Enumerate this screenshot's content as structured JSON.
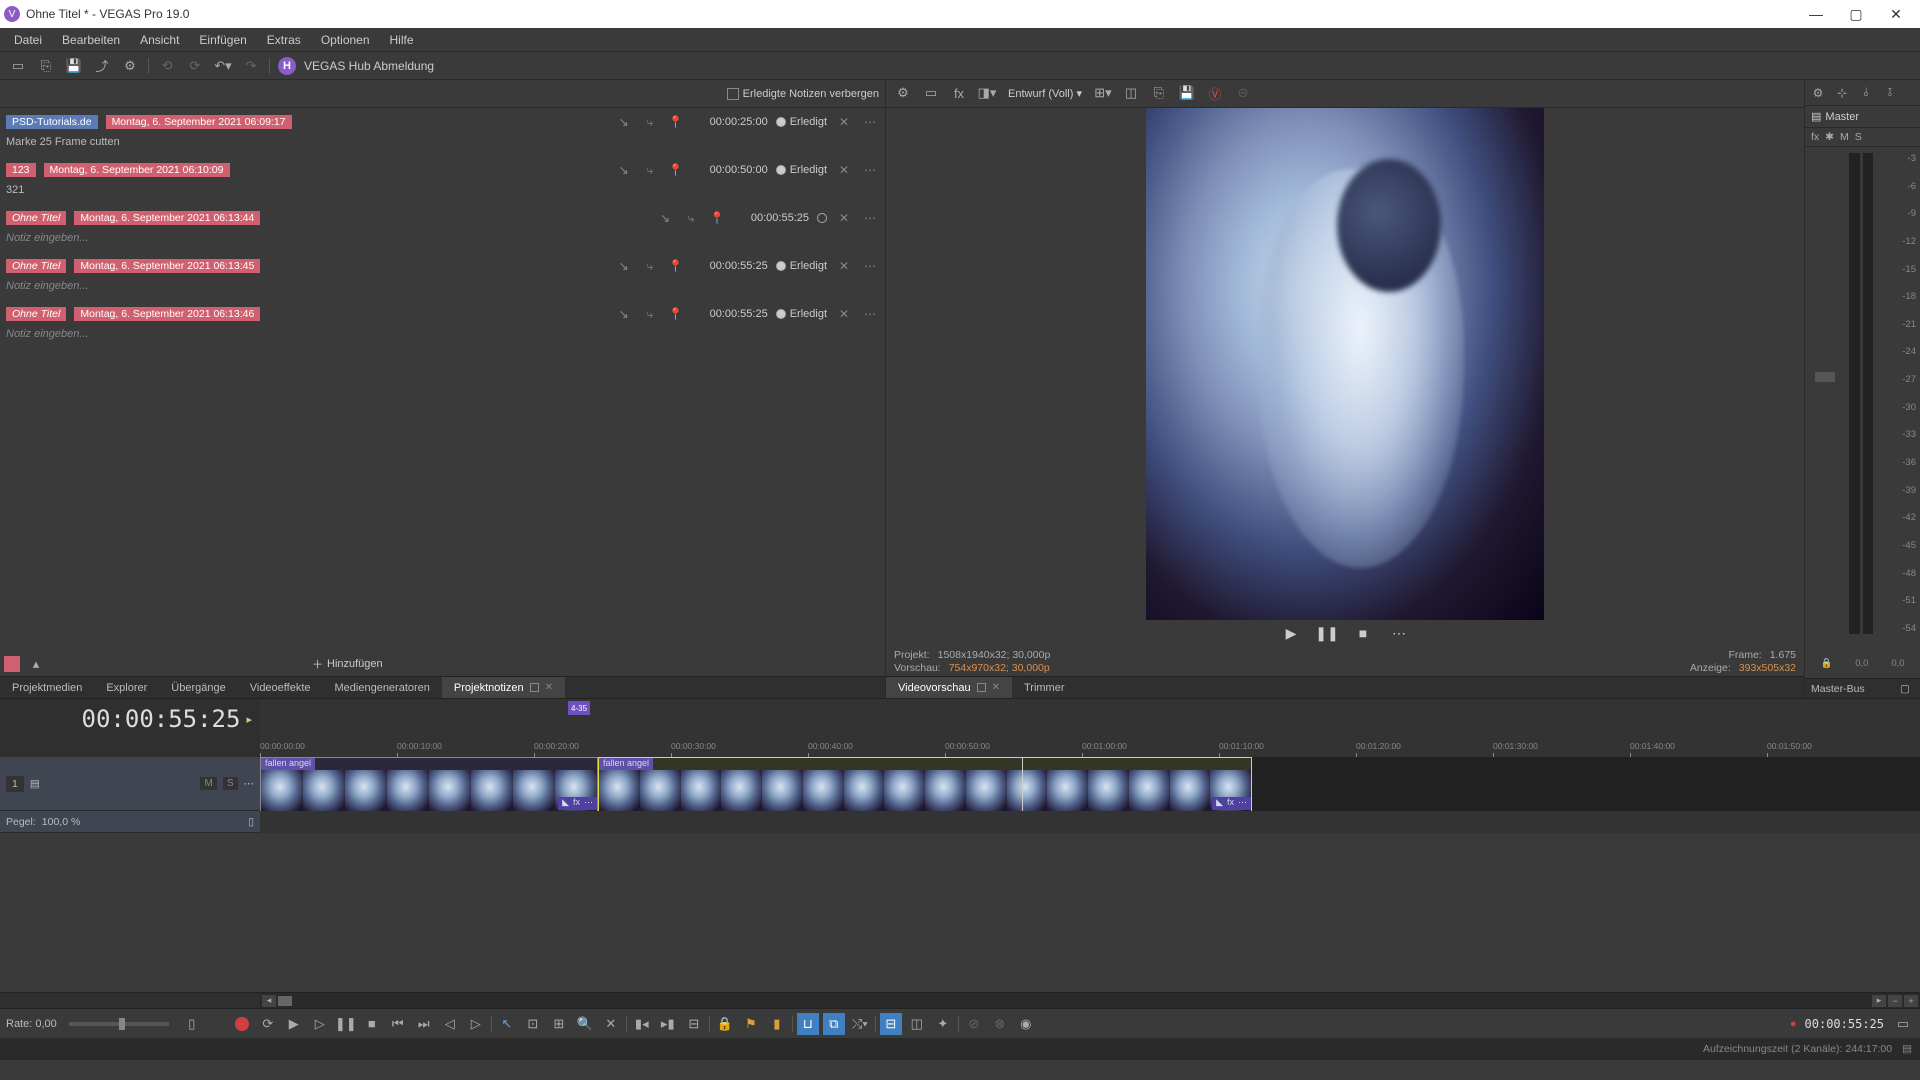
{
  "window": {
    "title": "Ohne Titel * - VEGAS Pro 19.0",
    "logo_char": "V"
  },
  "menu": [
    "Datei",
    "Bearbeiten",
    "Ansicht",
    "Einfügen",
    "Extras",
    "Optionen",
    "Hilfe"
  ],
  "hub": {
    "char": "H",
    "text": "VEGAS Hub Abmeldung"
  },
  "notes": {
    "hide_completed_label": "Erledigte Notizen verbergen",
    "items": [
      {
        "tag": "PSD-Tutorials.de",
        "tag_style": "blue",
        "date": "Montag, 6. September 2021 06:09:17",
        "desc": "Marke 25 Frame cutten",
        "tc": "00:00:25:00",
        "status": "done",
        "status_label": "Erledigt",
        "shifted": false
      },
      {
        "tag": "123",
        "tag_style": "red-solid",
        "date": "Montag, 6. September 2021 06:10:09",
        "desc": "321",
        "tc": "00:00:50:00",
        "status": "done",
        "status_label": "Erledigt",
        "shifted": false
      },
      {
        "tag": "Ohne Titel",
        "tag_style": "red",
        "date": "Montag, 6. September 2021 06:13:44",
        "placeholder": "Notiz eingeben...",
        "tc": "00:00:55:25",
        "status": "open",
        "status_label": "",
        "shifted": true
      },
      {
        "tag": "Ohne Titel",
        "tag_style": "red",
        "date": "Montag, 6. September 2021 06:13:45",
        "placeholder": "Notiz eingeben...",
        "tc": "00:00:55:25",
        "status": "done",
        "status_label": "Erledigt",
        "shifted": false
      },
      {
        "tag": "Ohne Titel",
        "tag_style": "red",
        "date": "Montag, 6. September 2021 06:13:46",
        "placeholder": "Notiz eingeben...",
        "tc": "00:00:55:25",
        "status": "done",
        "status_label": "Erledigt",
        "shifted": false
      }
    ],
    "add_label": "Hinzufügen"
  },
  "tabs_left": [
    {
      "label": "Projektmedien"
    },
    {
      "label": "Explorer"
    },
    {
      "label": "Übergänge"
    },
    {
      "label": "Videoeffekte"
    },
    {
      "label": "Mediengeneratoren"
    },
    {
      "label": "Projektnotizen",
      "active": true,
      "closable": true
    }
  ],
  "preview": {
    "quality_label": "Entwurf (Voll)",
    "playback": {
      "play": "▶",
      "pause": "❚❚",
      "stop": "■",
      "more": "⋯"
    },
    "info": {
      "projekt_label": "Projekt:",
      "projekt_val": "1508x1940x32; 30,000p",
      "vorschau_label": "Vorschau:",
      "vorschau_val": "754x970x32; 30,000p",
      "frame_label": "Frame:",
      "frame_val": "1.675",
      "anzeige_label": "Anzeige:",
      "anzeige_val": "393x505x32"
    }
  },
  "tabs_right": [
    {
      "label": "Videovorschau",
      "active": true,
      "closable": true
    },
    {
      "label": "Trimmer"
    }
  ],
  "master": {
    "title": "Master",
    "sub": [
      "fx",
      "✱",
      "M",
      "S"
    ],
    "scale": [
      "-3",
      "-6",
      "-9",
      "-12",
      "-15",
      "-18",
      "-21",
      "-24",
      "-27",
      "-30",
      "-33",
      "-36",
      "-39",
      "-42",
      "-45",
      "-48",
      "-51",
      "-54"
    ],
    "foot": [
      "0,0",
      "0,0"
    ],
    "tab_label": "Master-Bus"
  },
  "timeline": {
    "timecode": "00:00:55:25",
    "marker_label": "4-35",
    "ruler_ticks": [
      "00:00:00:00",
      "00:00:10:00",
      "00:00:20:00",
      "00:00:30:00",
      "00:00:40:00",
      "00:00:50:00",
      "00:01:00:00",
      "00:01:10:00",
      "00:01:20:00",
      "00:01:30:00",
      "00:01:40:00",
      "00:01:50:00"
    ],
    "track": {
      "number": "1",
      "pegel_label": "Pegel:",
      "pegel_val": "100,0 %",
      "m": "M",
      "s": "S"
    },
    "clip1_label": "fallen angel",
    "clip2_label": "fallen angel",
    "fx_label": "fx",
    "tri": "◣"
  },
  "footer": {
    "rate_label": "Rate: 0,00",
    "timecode": "00:00:55:25"
  },
  "status": {
    "text": "Aufzeichnungszeit (2 Kanäle): 244:17:00"
  }
}
